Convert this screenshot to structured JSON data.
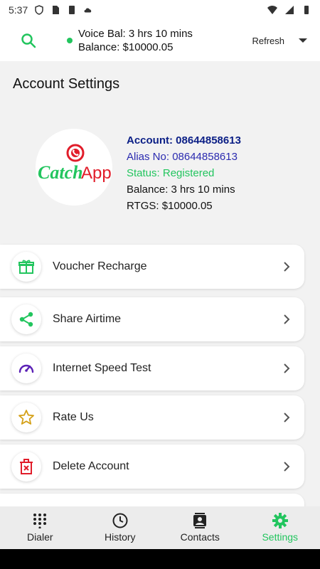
{
  "status_bar": {
    "time": "5:37"
  },
  "header": {
    "voice_balance": "Voice Bal: 3 hrs 10 mins",
    "balance": "Balance: $10000.05",
    "refresh_label": "Refresh"
  },
  "page": {
    "title": "Account Settings"
  },
  "logo": {
    "text_catch": "Catch",
    "text_app": "App"
  },
  "account": {
    "number": "Account: 08644858613",
    "alias": "Alias No: 08644858613",
    "status": "Status: Registered",
    "balance": "Balance: 3 hrs 10 mins",
    "rtgs": "RTGS: $10000.05"
  },
  "menu": [
    {
      "label": "Voucher Recharge",
      "icon": "gift-icon"
    },
    {
      "label": "Share Airtime",
      "icon": "share-icon"
    },
    {
      "label": "Internet Speed Test",
      "icon": "speedometer-icon"
    },
    {
      "label": "Rate Us",
      "icon": "star-icon"
    },
    {
      "label": "Delete Account",
      "icon": "trash-icon"
    }
  ],
  "bottom_nav": [
    {
      "label": "Dialer",
      "icon": "dialpad-icon"
    },
    {
      "label": "History",
      "icon": "clock-icon"
    },
    {
      "label": "Contacts",
      "icon": "contacts-icon"
    },
    {
      "label": "Settings",
      "icon": "gear-icon",
      "active": true
    }
  ],
  "colors": {
    "accent": "#22c55e",
    "account_number": "#0b1f86",
    "alias": "#2b2bb0",
    "brand_red": "#e11d2a",
    "speed_icon": "#5b21b6",
    "star_icon": "#d4a017"
  }
}
